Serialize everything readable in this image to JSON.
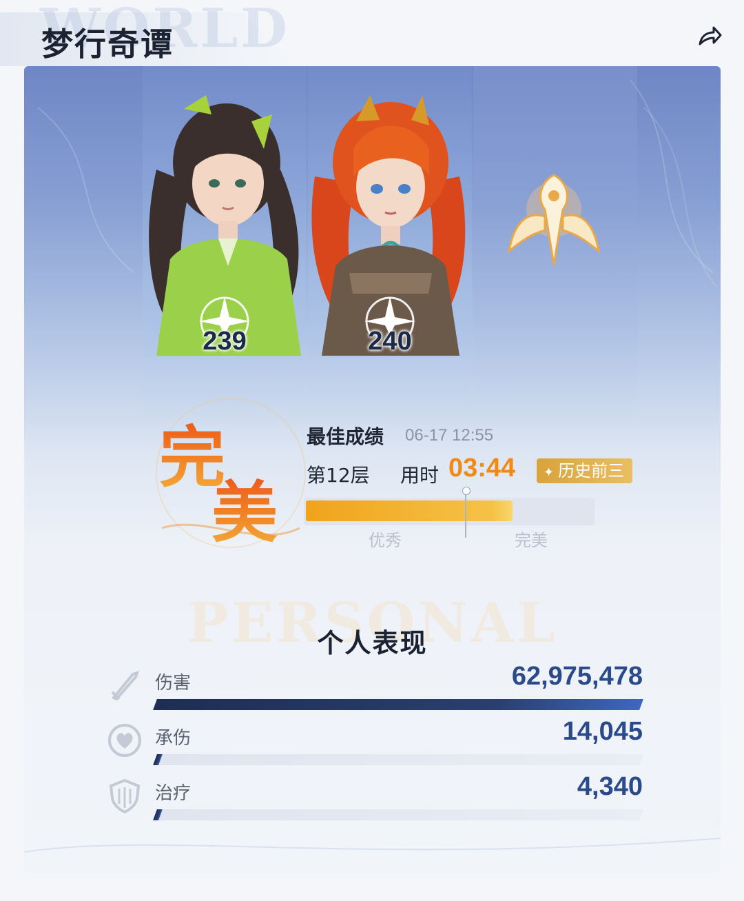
{
  "header": {
    "title": "梦行奇谭",
    "watermark": "WORLD"
  },
  "team": {
    "characters": [
      {
        "level": "239",
        "hair_color": "#3a2f2d",
        "outfit_color": "#9ad04a"
      },
      {
        "level": "240",
        "hair_color": "#d9461c",
        "outfit_color": "#6b5a4a"
      }
    ],
    "pet": {
      "icon": "phoenix-emblem-icon"
    }
  },
  "result": {
    "grade": "完美",
    "best_label": "最佳成绩",
    "best_time": "06-17 12:55",
    "floor": "第12层",
    "time_label": "用时",
    "time_value": "03:44",
    "history_badge": "历史前三",
    "progress": 0.72,
    "tiers": [
      "优秀",
      "完美"
    ]
  },
  "personal": {
    "watermark": "PERSONAL",
    "title": "个人表现",
    "stats": [
      {
        "label": "伤害",
        "value": "62,975,478",
        "ratio": 1.0,
        "icon": "sword-icon"
      },
      {
        "label": "承伤",
        "value": "14,045",
        "ratio": 0.012,
        "icon": "heart-shield-icon"
      },
      {
        "label": "治疗",
        "value": "4,340",
        "ratio": 0.012,
        "icon": "shield-icon"
      }
    ]
  },
  "colors": {
    "accent_orange": "#f08a12",
    "value_blue": "#2a4a8c",
    "badge_gold": "#d9a23c"
  }
}
